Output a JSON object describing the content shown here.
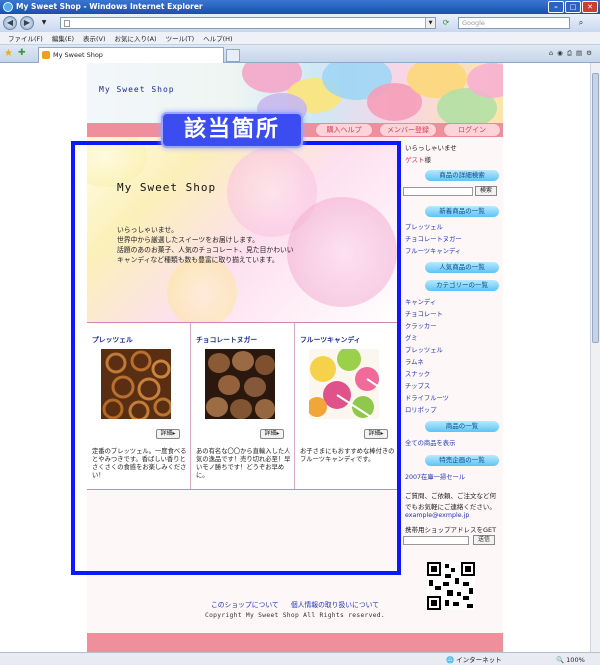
{
  "browser": {
    "title": "My Sweet Shop - Windows Internet Explorer",
    "search_placeholder": "Google",
    "menu": [
      "ファイル(F)",
      "編集(E)",
      "表示(V)",
      "お気に入り(A)",
      "ツール(T)",
      "ヘルプ(H)"
    ],
    "tab_label": "My Sweet Shop",
    "status_zone": "インターネット",
    "zoom": "100%"
  },
  "site": {
    "logo": "My Sweet Shop",
    "nav": [
      "購入ヘルプ",
      "メンバー登録",
      "ログイン"
    ],
    "hero_title": "My Sweet Shop",
    "hero_lines": [
      "いらっしゃいませ。",
      "世界中から厳選したスイーツをお届けします。",
      "話題のあのお菓子、人気のチョコレート、見た目かわいい",
      "キャンディなど種類も数も豊富に取り揃えています。"
    ],
    "detail_label": "詳細▸",
    "products": [
      {
        "name": "プレッツェル",
        "desc": "定番のプレッツェル。一度食べるとやみつきです。香ばしい香りとさくさくの食感をお楽しみください！"
      },
      {
        "name": "チョコレートヌガー",
        "desc": "あの有名な〇〇から直輸入した人気の逸品です！売り切れ必至！早いモノ勝ちです！どうぞお早めに。"
      },
      {
        "name": "フルーツキャンディ",
        "desc": "お子さまにもおすすめな棒付きのフルーツキャンディです。"
      }
    ],
    "sidebar": {
      "greeting": "いらっしゃいませ",
      "guest": "ゲスト",
      "guest_suffix": "様",
      "detail_search": "商品の詳細検索",
      "search_btn": "検索",
      "new_list": "新着商品の一覧",
      "new_items": [
        "プレッツェル",
        "チョコレートヌガー",
        "フルーツキャンディ"
      ],
      "popular_list": "人気商品の一覧",
      "category_list": "カテゴリーの一覧",
      "categories": [
        "キャンディ",
        "チョコレート",
        "クラッカー",
        "グミ",
        "プレッツェル",
        "ラムネ",
        "スナック",
        "チップス",
        "ドライフルーツ",
        "ロリポップ"
      ],
      "product_list": "商品の一覧",
      "all_products": "全ての商品を表示",
      "special_list": "特売企画の一覧",
      "special_item": "2007在庫一掃セール",
      "contact_line1": "ご質問、ご依頼、ご注文など何",
      "contact_line2": "でもお気軽にご連絡ください。",
      "email": "example@exmple.jp",
      "mobile_label": "携帯用ショップアドレスをGET",
      "send_btn": "送信"
    },
    "footer_links": [
      "このショップについて",
      "個人情報の取り扱いについて"
    ],
    "copyright": "Copyright My Sweet Shop All Rights reserved."
  },
  "annotation": {
    "label": "該当箇所",
    "color": "#0b19ff"
  }
}
